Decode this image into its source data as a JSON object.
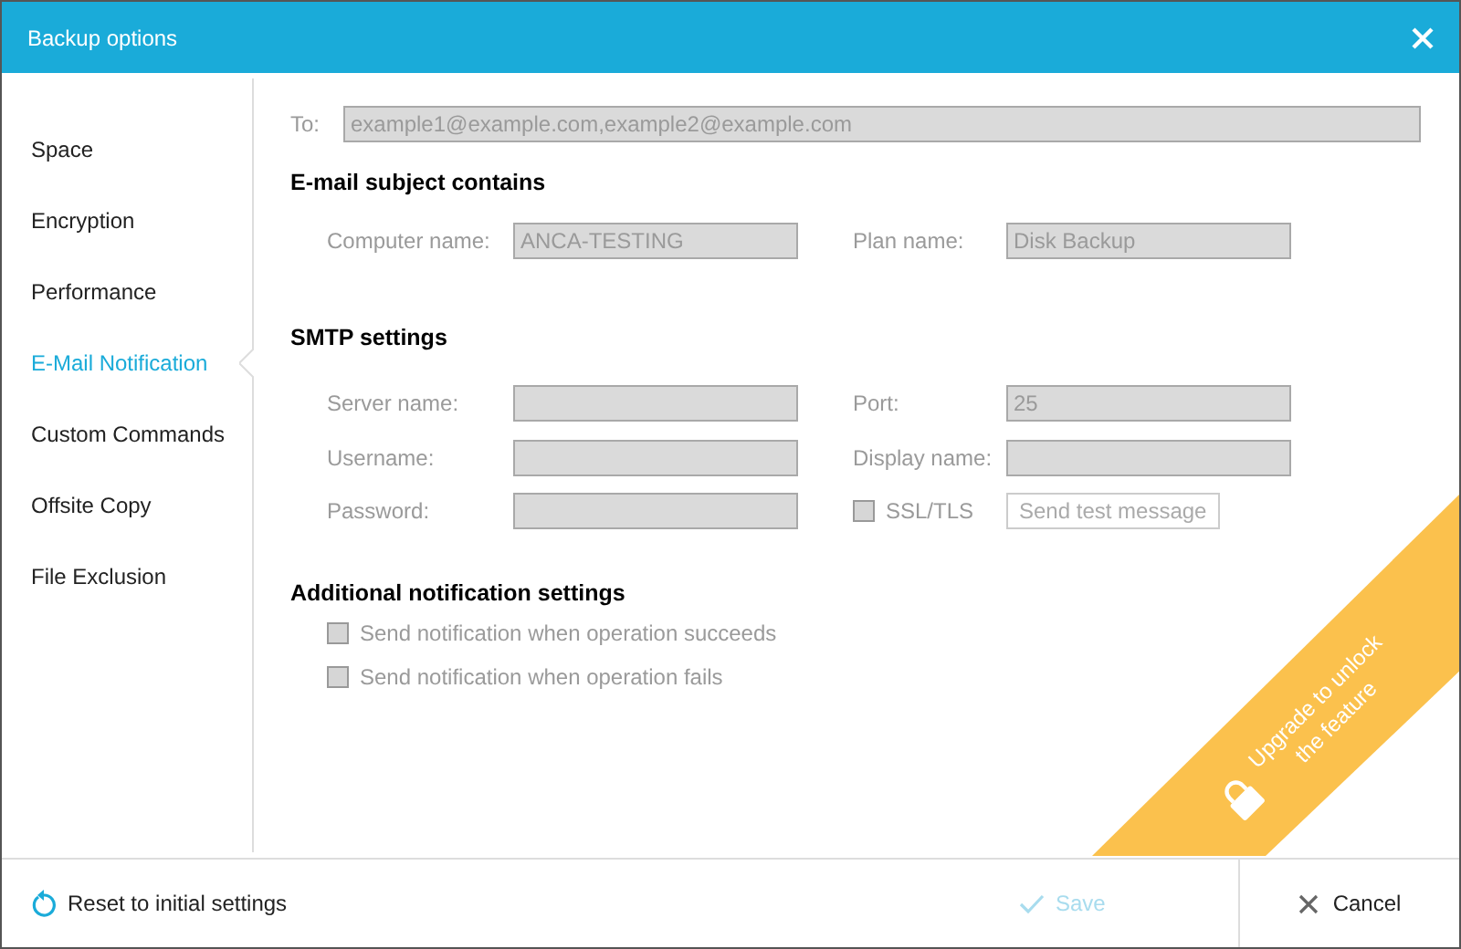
{
  "window": {
    "title": "Backup options"
  },
  "sidebar": {
    "items": [
      {
        "label": "Space",
        "selected": false
      },
      {
        "label": "Encryption",
        "selected": false
      },
      {
        "label": "Performance",
        "selected": false
      },
      {
        "label": "E-Mail Notification",
        "selected": true
      },
      {
        "label": "Custom Commands",
        "selected": false
      },
      {
        "label": "Offsite Copy",
        "selected": false
      },
      {
        "label": "File Exclusion",
        "selected": false
      }
    ]
  },
  "form": {
    "disabled": true,
    "to": {
      "label": "To:",
      "value": "example1@example.com,example2@example.com"
    },
    "subject": {
      "heading": "E-mail subject contains",
      "fields": [
        {
          "label": "Computer name:",
          "value": "ANCA-TESTING"
        },
        {
          "label": "Plan name:",
          "value": "Disk Backup"
        }
      ]
    },
    "smtp": {
      "heading": "SMTP settings",
      "fields": [
        {
          "label": "Server name:"
        },
        {
          "label": "Port:",
          "value": "25"
        },
        {
          "label": "Username:"
        },
        {
          "label": "Display name:"
        },
        {
          "label": "Password:"
        }
      ],
      "ssl": {
        "label": "SSL/TLS",
        "checked": false
      },
      "test_button": "Send test message"
    },
    "additional": {
      "heading": "Additional notification settings",
      "options": [
        {
          "label": "Send notification when operation succeeds",
          "checked": false
        },
        {
          "label": "Send notification when operation fails",
          "checked": false
        }
      ]
    }
  },
  "banner": {
    "lines": [
      "Upgrade to unlock",
      "the feature"
    ]
  },
  "footer": {
    "reset": "Reset to initial settings",
    "save": {
      "label": "Save",
      "disabled": true
    },
    "cancel": "Cancel"
  }
}
